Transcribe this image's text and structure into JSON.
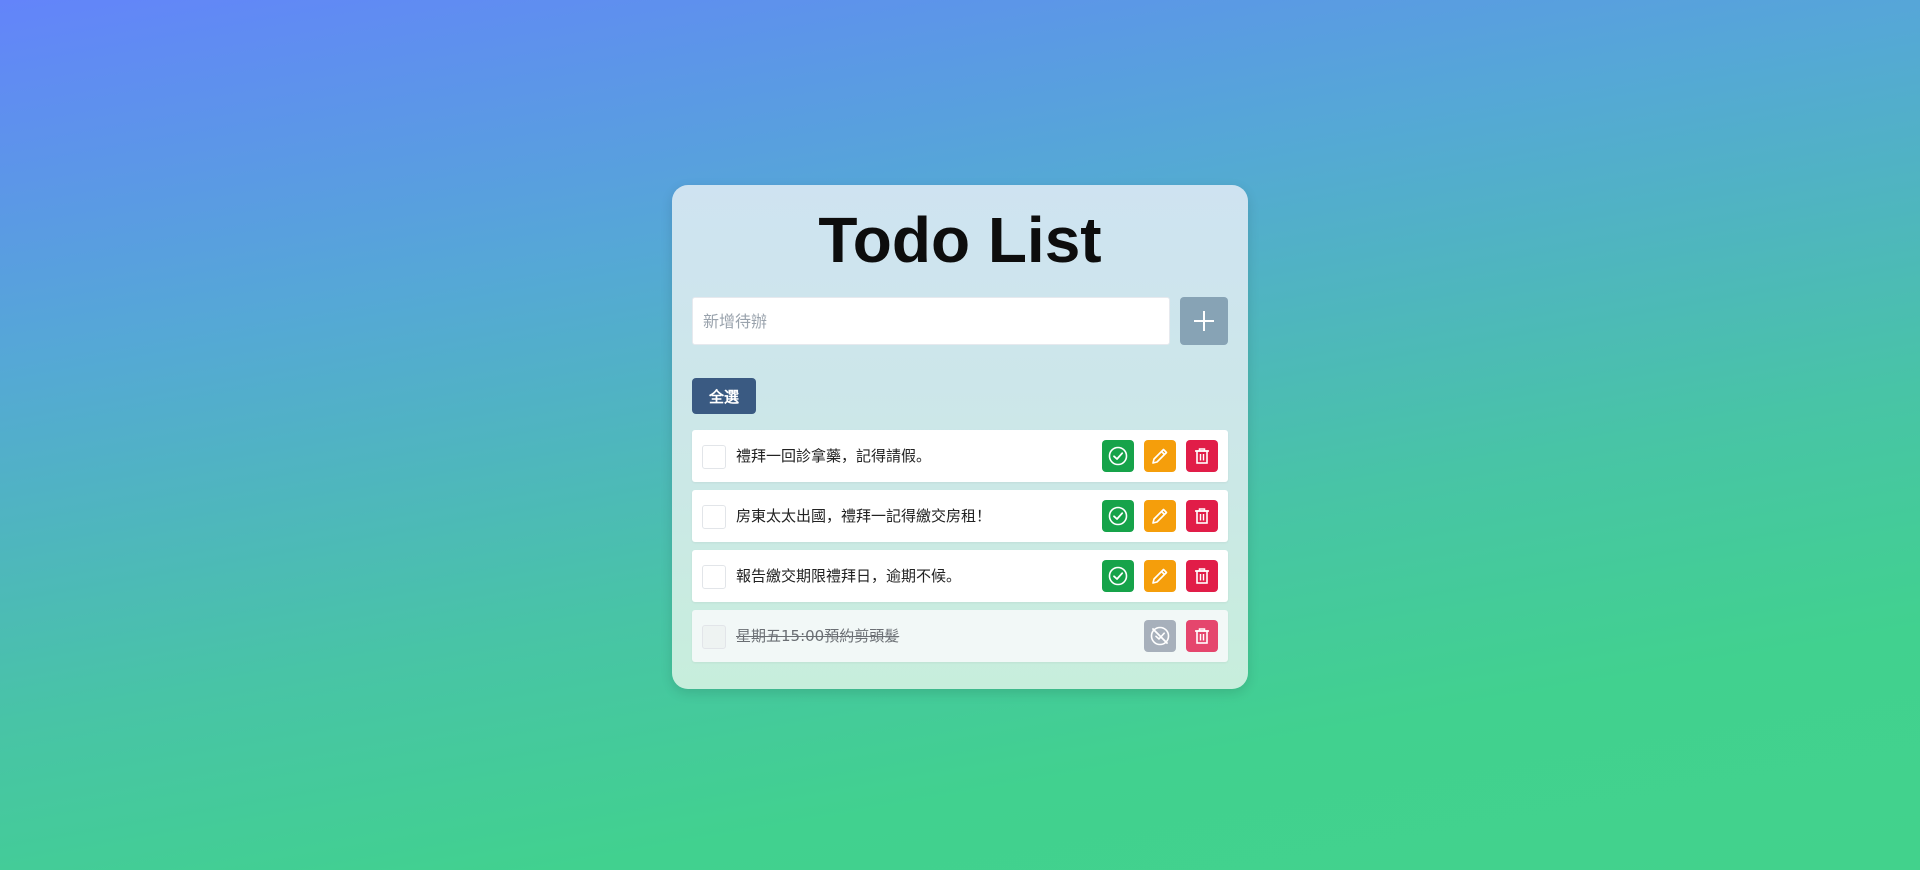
{
  "title": "Todo List",
  "input": {
    "placeholder": "新增待辦",
    "value": ""
  },
  "add_button": {
    "icon": "plus-icon"
  },
  "select_all_label": "全選",
  "todos": [
    {
      "text": "禮拜一回診拿藥，記得請假。",
      "completed": false
    },
    {
      "text": "房東太太出國，禮拜一記得繳交房租！",
      "completed": false
    },
    {
      "text": "報告繳交期限禮拜日，逾期不候。",
      "completed": false
    },
    {
      "text": "星期五15:00預約剪頭髮",
      "completed": true
    }
  ],
  "colors": {
    "complete": "#16a34a",
    "edit": "#f59e0b",
    "delete": "#e11d48",
    "add": "#87a3b5",
    "select_all": "#3a5a82",
    "undo": "#a7b0bb"
  }
}
